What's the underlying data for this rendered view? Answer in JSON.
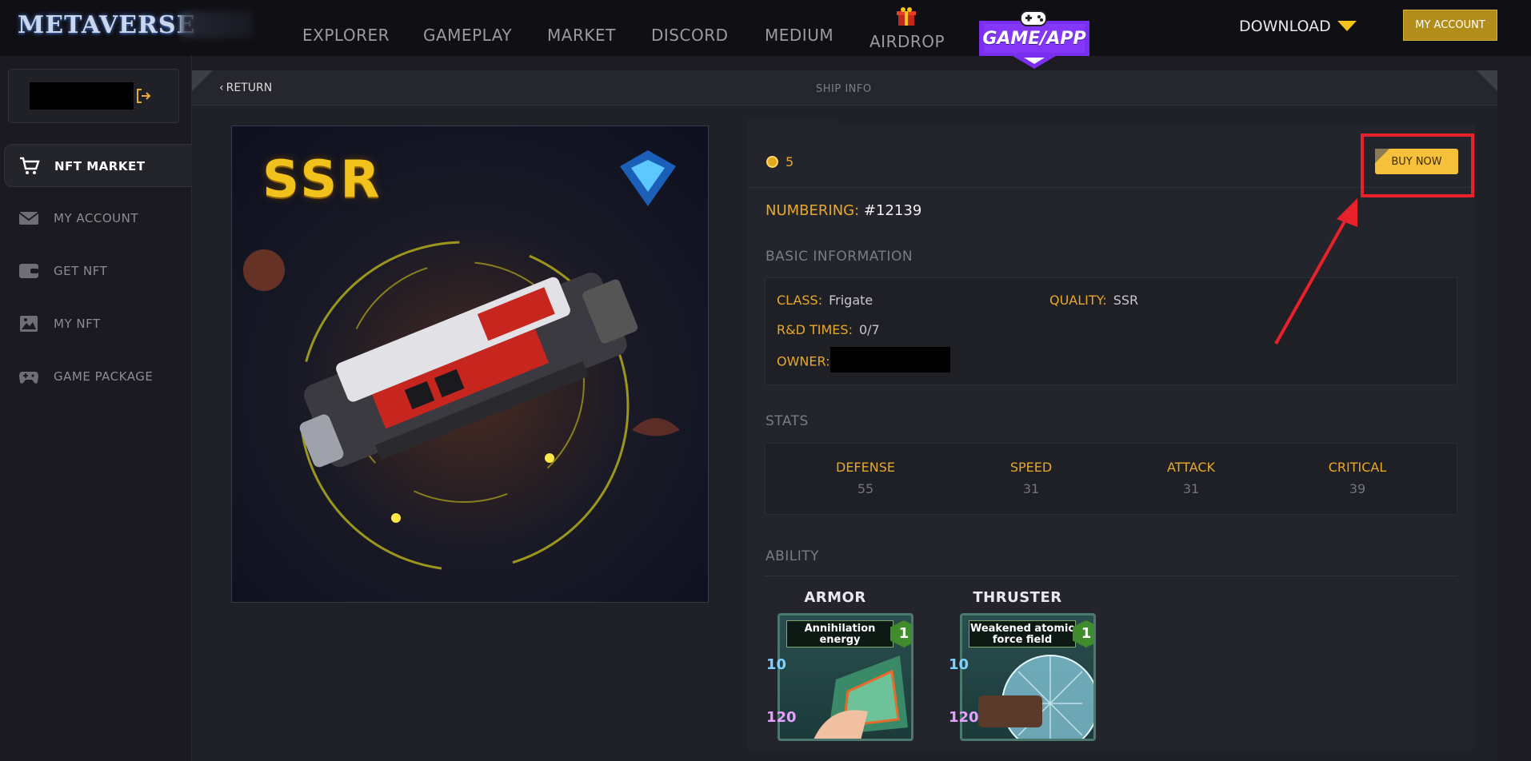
{
  "header": {
    "logo_text": "METAVERSE",
    "nav": [
      "EXPLORER",
      "GAMEPLAY",
      "MARKET",
      "DISCORD",
      "MEDIUM",
      "AIRDROP"
    ],
    "game_app_label": "GAME/APP",
    "download_label": "DOWNLOAD",
    "account_button": "MY ACCOUNT",
    "accent_color": "#f3c31a"
  },
  "sidebar": {
    "items": [
      {
        "label": "NFT MARKET",
        "icon": "cart-icon",
        "active": true
      },
      {
        "label": "MY ACCOUNT",
        "icon": "mail-icon",
        "active": false
      },
      {
        "label": "GET NFT",
        "icon": "wallet-icon",
        "active": false
      },
      {
        "label": "MY NFT",
        "icon": "image-icon",
        "active": false
      },
      {
        "label": "GAME PACKAGE",
        "icon": "gamepad-icon",
        "active": false
      }
    ]
  },
  "panel": {
    "return_label": "RETURN",
    "title": "SHIP INFO"
  },
  "ship": {
    "rarity_badge": "SSR",
    "price": "5",
    "buy_button": "BUY NOW",
    "numbering_label": "NUMBERING:",
    "numbering_value": "#12139",
    "basic_title": "BASIC INFORMATION",
    "class_label": "CLASS:",
    "class_value": "Frigate",
    "quality_label": "QUALITY:",
    "quality_value": "SSR",
    "rd_label": "R&D TIMES:",
    "rd_value": "0/7",
    "owner_label": "OWNER:",
    "stats_title": "STATS",
    "stats": [
      {
        "label": "DEFENSE",
        "value": "55"
      },
      {
        "label": "SPEED",
        "value": "31"
      },
      {
        "label": "ATTACK",
        "value": "31"
      },
      {
        "label": "CRITICAL",
        "value": "39"
      }
    ],
    "ability_title": "ABILITY",
    "abilities": [
      {
        "name": "ARMOR",
        "card_title": "Annihilation energy",
        "level": "1",
        "stat1": "10",
        "stat2": "120"
      },
      {
        "name": "THRUSTER",
        "card_title": "Weakened atomic force field",
        "level": "1",
        "stat1": "10",
        "stat2": "120"
      }
    ]
  }
}
